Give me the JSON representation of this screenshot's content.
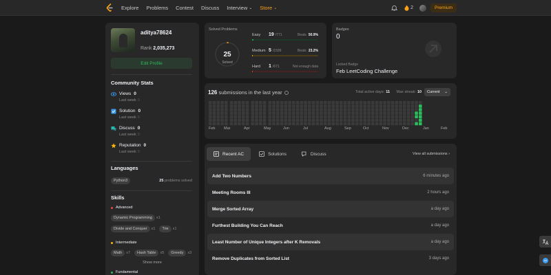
{
  "nav": {
    "items": [
      "Explore",
      "Problems",
      "Contest",
      "Discuss"
    ],
    "interview": "Interview",
    "store": "Store",
    "streak": "2",
    "premium": "Premium"
  },
  "profile": {
    "username": "aditya78624",
    "rank_label": "Rank",
    "rank_value": "2,035,273",
    "edit": "Edit Profile"
  },
  "community": {
    "title": "Community Stats",
    "stats": [
      {
        "label": "Views",
        "value": "0",
        "sub": "Last week",
        "delta": "0"
      },
      {
        "label": "Solution",
        "value": "0",
        "sub": "Last week",
        "delta": "0"
      },
      {
        "label": "Discuss",
        "value": "0",
        "sub": "Last week",
        "delta": "0"
      },
      {
        "label": "Reputation",
        "value": "0",
        "sub": "Last week",
        "delta": "0"
      }
    ]
  },
  "languages": {
    "title": "Languages",
    "items": [
      {
        "name": "Python3",
        "count": "25",
        "suffix": "problems solved"
      }
    ]
  },
  "skills": {
    "title": "Skills",
    "advanced": {
      "label": "Advanced",
      "tags": [
        {
          "name": "Dynamic Programming",
          "count": "x1"
        },
        {
          "name": "Divide and Conquer",
          "count": "x1"
        },
        {
          "name": "Trie",
          "count": "x1"
        }
      ]
    },
    "intermediate": {
      "label": "Intermediate",
      "tags": [
        {
          "name": "Math",
          "count": "x7"
        },
        {
          "name": "Hash Table",
          "count": "x5"
        },
        {
          "name": "Greedy",
          "count": "x3"
        }
      ]
    },
    "show_more": "Show more",
    "fundamental": {
      "label": "Fundamental"
    }
  },
  "solved": {
    "title": "Solved Problems",
    "total": "25",
    "total_label": "Solved",
    "easy": {
      "name": "Easy",
      "solved": "19",
      "total": "/771",
      "beats_label": "Beats",
      "beats": "50.9%"
    },
    "medium": {
      "name": "Medium",
      "solved": "5",
      "total": "/1599",
      "beats_label": "Beats",
      "beats": "23.2%"
    },
    "hard": {
      "name": "Hard",
      "solved": "1",
      "total": "/671",
      "beats_label": "Not enough data",
      "beats": ""
    }
  },
  "badges": {
    "title": "Badges",
    "count": "0",
    "locked_label": "Locked Badge",
    "locked_name": "Feb LeetCoding Challenge"
  },
  "submissions": {
    "count": "126",
    "title_rest": "submissions in the last year",
    "active_days_label": "Total active days:",
    "active_days": "11",
    "max_streak_label": "Max streak:",
    "max_streak": "10",
    "period": "Current",
    "months": [
      "Feb",
      "Mar",
      "Apr",
      "May",
      "Jun",
      "Jul",
      "Aug",
      "Sep",
      "Oct",
      "Nov",
      "Dec",
      "Jan",
      "Feb"
    ]
  },
  "recent": {
    "tabs": [
      "Recent AC",
      "Solutions",
      "Discuss"
    ],
    "view_all": "View all submissions",
    "rows": [
      {
        "title": "Add Two Numbers",
        "when": "6 minutes ago"
      },
      {
        "title": "Meeting Rooms III",
        "when": "2 hours ago"
      },
      {
        "title": "Merge Sorted Array",
        "when": "a day ago"
      },
      {
        "title": "Furthest Building You Can Reach",
        "when": "a day ago"
      },
      {
        "title": "Least Number of Unique Integers after K Removals",
        "when": "a day ago"
      },
      {
        "title": "Remove Duplicates from Sorted List",
        "when": "3 days ago"
      }
    ]
  },
  "colors": {
    "accent": "#ffa116",
    "easy": "#2cbb5d",
    "medium": "#ffb800",
    "hard": "#ef4743",
    "heat_active": "#2cbb5d"
  }
}
